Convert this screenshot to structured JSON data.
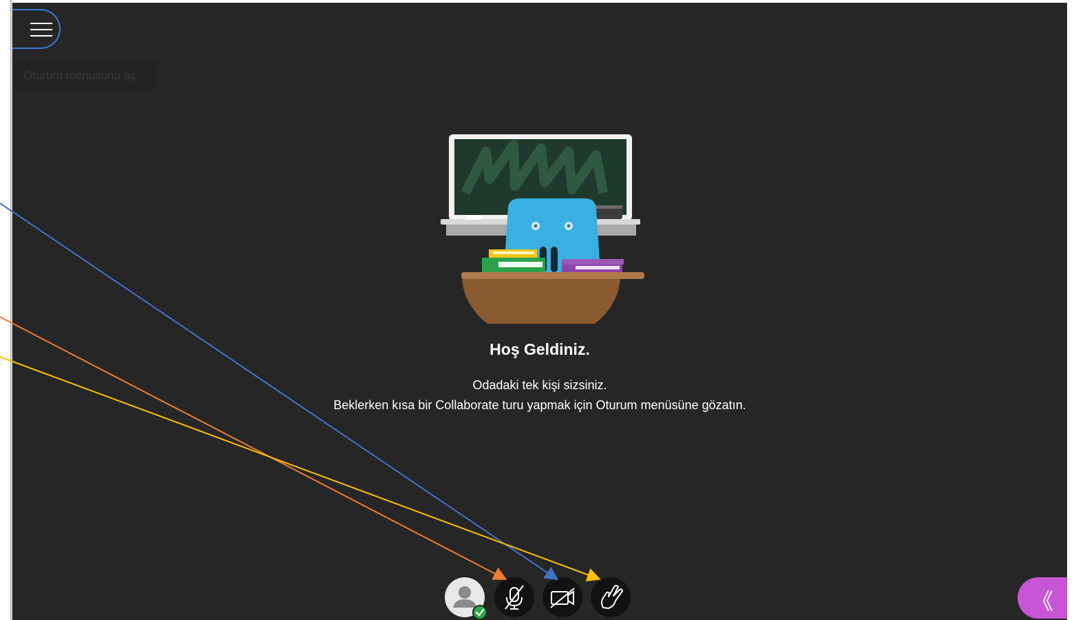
{
  "menu": {
    "tooltip": "Oturum menüsünü aç",
    "icon": "hamburger-menu-icon"
  },
  "welcome": {
    "title": "Hoş Geldiniz.",
    "line1": "Odadaki tek kişi sizsiniz.",
    "line2": "Beklerken kısa bir Collaborate turu yapmak için Oturum menüsüne gözatın."
  },
  "controls": {
    "avatar_icon": "user-avatar-icon",
    "status_icon": "check-icon",
    "mic_icon": "microphone-off-icon",
    "camera_icon": "camera-off-icon",
    "hand_icon": "raise-hand-icon"
  },
  "panel": {
    "collapse_label": "《",
    "collapse_icon": "double-chevron-left-icon"
  },
  "colors": {
    "stage_bg": "#262626",
    "accent_blue": "#3a7bd5",
    "panel_purple": "#c755d6",
    "arrow_blue": "#4472c4",
    "arrow_orange": "#ed7d31",
    "arrow_yellow": "#ffc000",
    "status_green": "#2aa84a"
  }
}
